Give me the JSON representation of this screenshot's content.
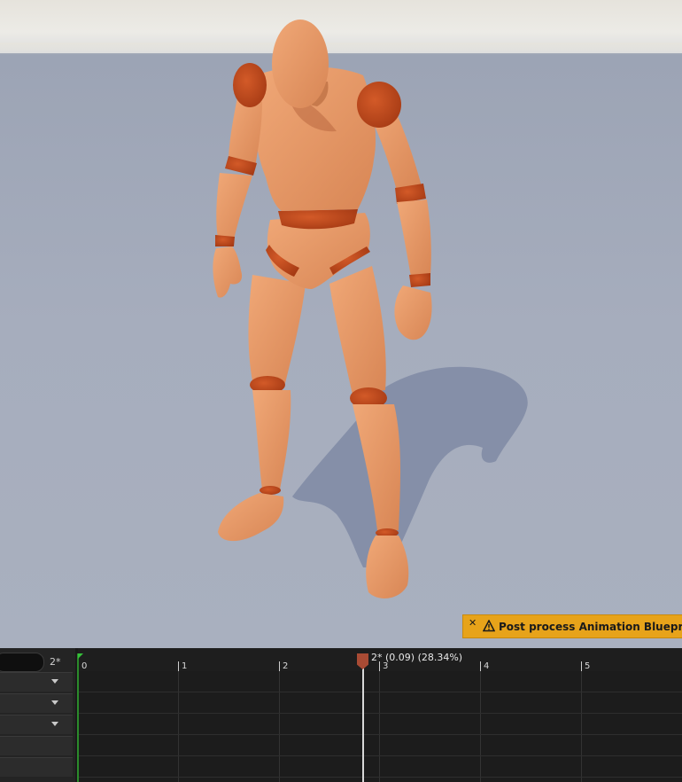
{
  "warning": {
    "close_icon": "close-icon",
    "icon": "warning-icon",
    "message": "Post process Animation Blueprint 'A"
  },
  "timeline": {
    "frame_label": "2*",
    "playhead": {
      "readout": "2* (0.09) (28.34%)"
    },
    "ruler_labels": [
      "0",
      "1",
      "2",
      "3",
      "4",
      "5"
    ],
    "track_rows": 5
  },
  "colors": {
    "skin": "#e89a66",
    "joint": "#c04a1e",
    "warning_bg": "#e7a31a",
    "playhead": "#a94b34",
    "start_marker": "#36c23a"
  }
}
